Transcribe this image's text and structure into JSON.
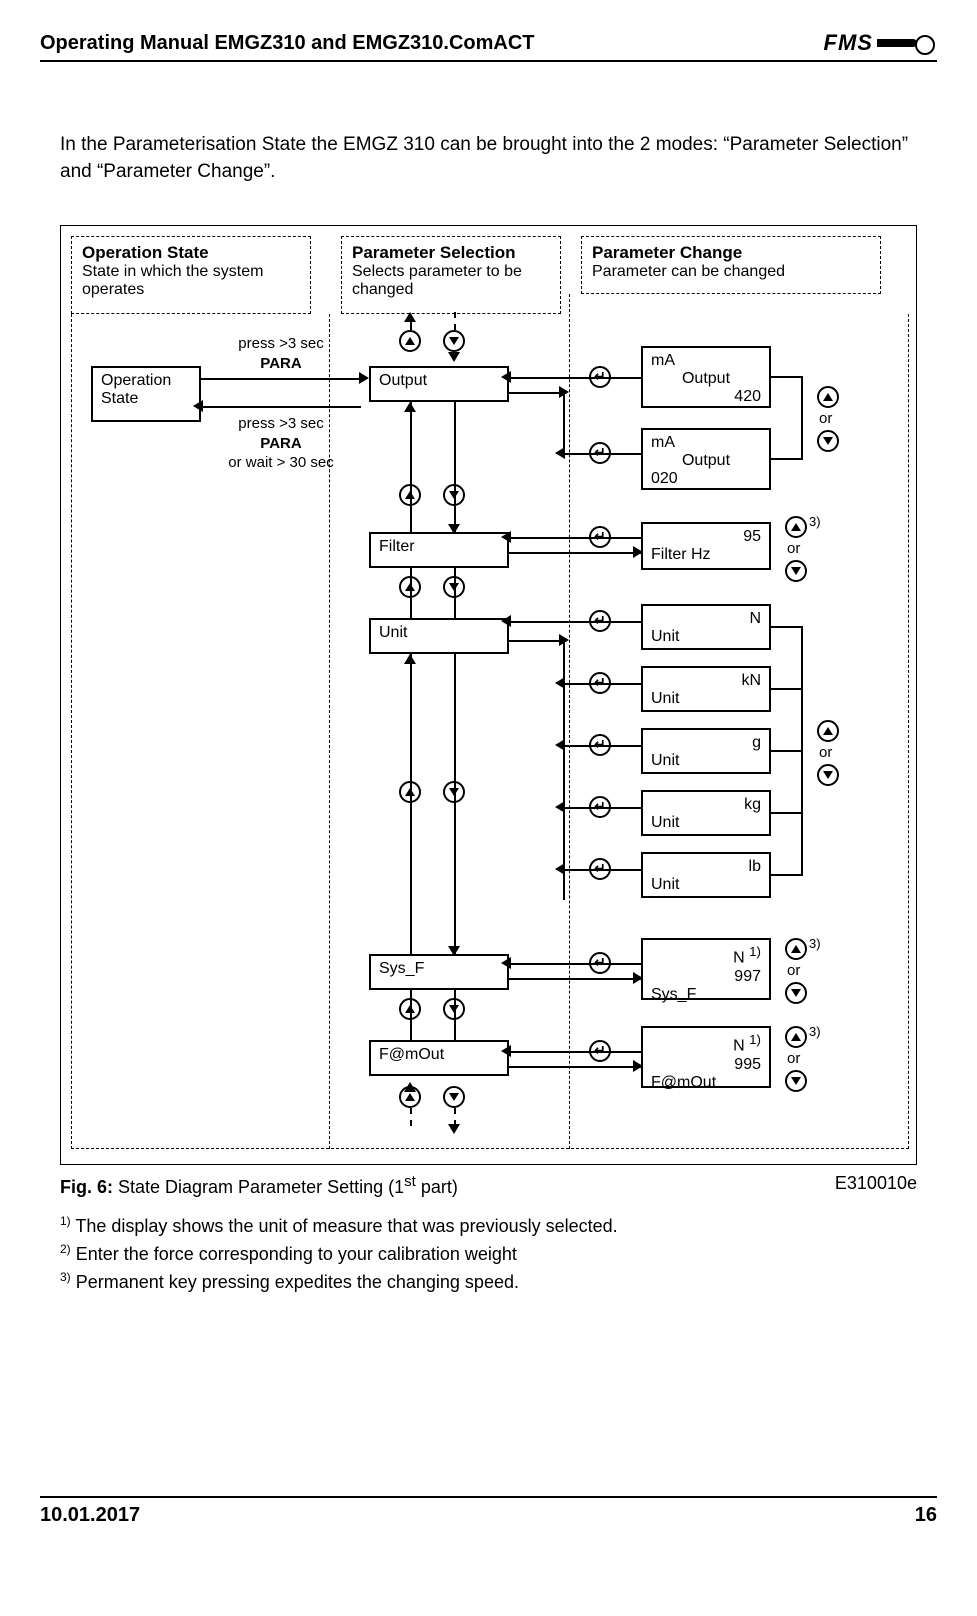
{
  "header": {
    "title": "Operating Manual EMGZ310 and EMGZ310.ComACT",
    "logo_text": "FMS"
  },
  "intro": "In the Parameterisation State the EMGZ 310 can be brought into the 2 modes: “Parameter Selection” and “Parameter Change”.",
  "columns": {
    "op": {
      "title": "Operation State",
      "sub": "State in which the system operates"
    },
    "sel": {
      "title": "Parameter Selection",
      "sub": "Selects parameter to be changed"
    },
    "chg": {
      "title": "Parameter Change",
      "sub": "Parameter can be changed"
    }
  },
  "boxes": {
    "op_state": "Operation\nState",
    "output": "Output",
    "filter": "Filter",
    "unit": "Unit",
    "sysf": "Sys_F",
    "fmout": "F@mOut",
    "ma420_l1": "mA",
    "ma420_l2": "Output",
    "ma420_v": "420",
    "ma020_l1": "mA",
    "ma020_l2": "Output",
    "ma020_v": "020",
    "filterhz_v": "95",
    "filterhz_l": "Filter Hz",
    "unit_n": "N",
    "unit_n_l": "Unit",
    "unit_kn": "kN",
    "unit_kn_l": "Unit",
    "unit_g": "g",
    "unit_g_l": "Unit",
    "unit_kg": "kg",
    "unit_kg_l": "Unit",
    "unit_lb": "lb",
    "unit_lb_l": "Unit",
    "sysf_u": "N",
    "sysf_sup": "1)",
    "sysf_v": "997",
    "sysf_l": "Sys_F",
    "fmout_u": "N",
    "fmout_sup": "1)",
    "fmout_v": "995",
    "fmout_l": "F@mOut"
  },
  "labels": {
    "to_output_1": "press >3 sec",
    "to_output_2": "PARA",
    "back_1": "press >3 sec",
    "back_2": "PARA",
    "back_3": "or wait > 30 sec",
    "or": "or",
    "note3": "3)"
  },
  "caption": {
    "fig": "Fig. 6:",
    "text": " State Diagram Parameter Setting (1",
    "sup": "st",
    "text2": " part)",
    "code": "E310010e"
  },
  "footnotes": {
    "f1": "The display shows the unit of measure that was previously selected.",
    "f2": "Enter the force corresponding to your calibration weight",
    "f3": "Permanent key pressing expedites the changing speed."
  },
  "footer": {
    "date": "10.01.2017",
    "page": "16"
  }
}
